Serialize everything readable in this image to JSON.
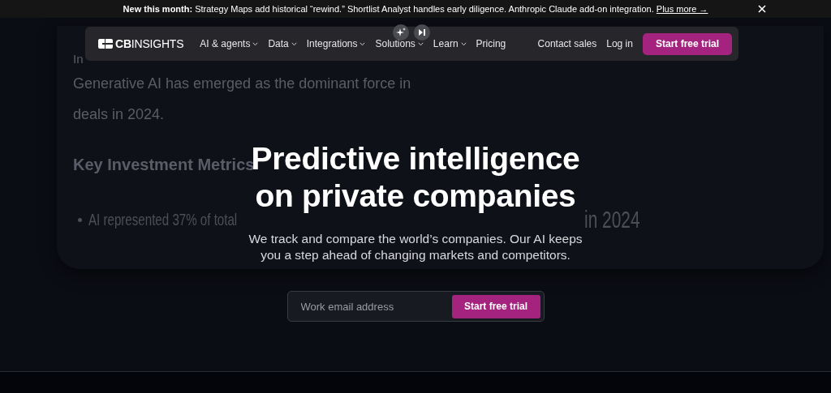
{
  "announcement": {
    "label": "New this month:",
    "text": "Strategy Maps add historical “rewind.” Shortlist Analyst handles early diligence. Anthropic Claude add-on integration.",
    "link": "Plus more →"
  },
  "nav": {
    "logo": "**CB**INSIGHTS",
    "items": [
      {
        "label": "AI & agents",
        "dropdown": true
      },
      {
        "label": "Data",
        "dropdown": true
      },
      {
        "label": "Integrations",
        "dropdown": true
      },
      {
        "label": "Solutions",
        "dropdown": true
      },
      {
        "label": "Learn",
        "dropdown": true
      },
      {
        "label": "Pricing",
        "dropdown": false
      }
    ],
    "contact": "Contact sales",
    "login": "Log in",
    "cta": "Start free trial"
  },
  "background_card": {
    "fragment": "In",
    "paragraph": [
      "Generative AI has emerged as the dominant force in",
      "deals in 2024."
    ],
    "heading": "Key Investment Metrics",
    "bullets": [
      {
        "visible_parts": [
          "AI represented 37% of total",
          "in 2024"
        ]
      }
    ]
  },
  "hero": {
    "title_lines": [
      "Predictive intelligence",
      "on private companies"
    ],
    "subtitle_lines": [
      "We track and compare the world’s companies. Our AI keeps",
      "you a step ahead of changing markets and competitors."
    ],
    "email": {
      "placeholder": "Work email address"
    },
    "cta": "Start free trial"
  }
}
